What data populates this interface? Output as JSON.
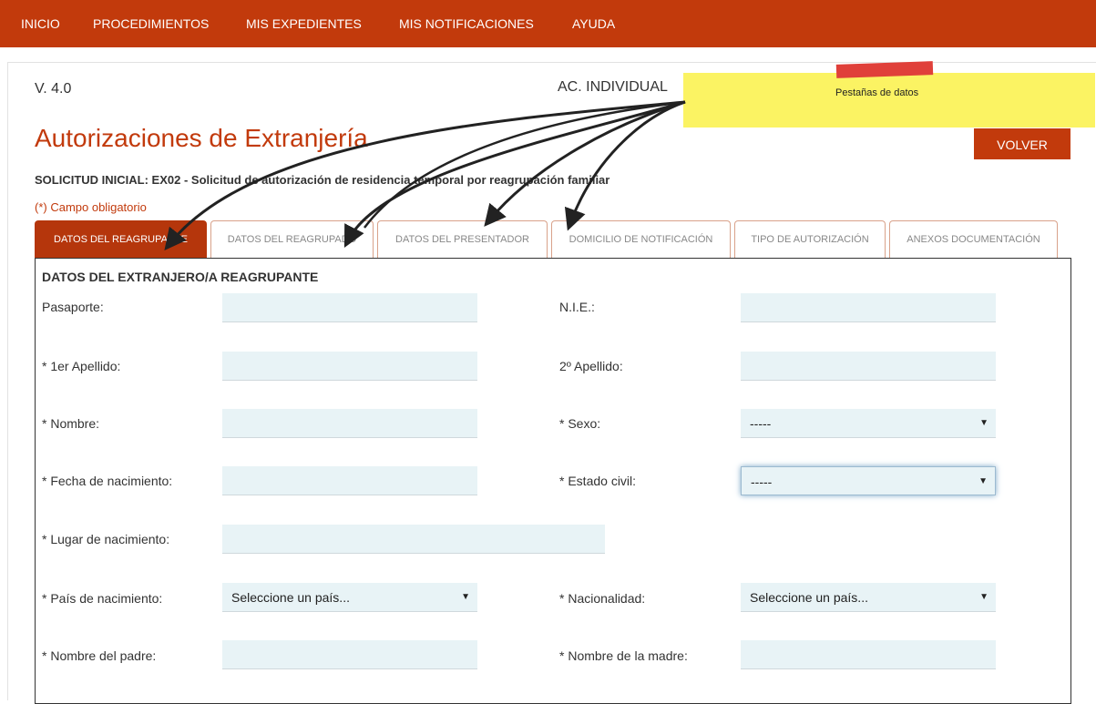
{
  "nav": {
    "items": [
      "INICIO",
      "PROCEDIMIENTOS",
      "MIS EXPEDIENTES",
      "MIS NOTIFICACIONES",
      "AYUDA"
    ]
  },
  "header": {
    "version": "V. 4.0",
    "mode": "AC. INDIVIDUAL",
    "title": "Autorizaciones de Extranjería",
    "volver_label": "VOLVER",
    "subtitle": "SOLICITUD INICIAL: EX02 - Solicitud de autorización de residencia temporal por reagrupación familiar",
    "required_note": "(*) Campo obligatorio"
  },
  "tabs": [
    "DATOS DEL REAGRUPANTE",
    "DATOS DEL REAGRUPADO",
    "DATOS DEL PRESENTADOR",
    "DOMICILIO DE NOTIFICACIÓN",
    "TIPO DE AUTORIZACIÓN",
    "ANEXOS DOCUMENTACIÓN"
  ],
  "active_tab": "DATOS DEL REAGRUPANTE",
  "form": {
    "section_title": "DATOS DEL EXTRANJERO/A REAGRUPANTE",
    "labels": {
      "pasaporte": "Pasaporte:",
      "nie": "N.I.E.:",
      "apellido1": "* 1er Apellido:",
      "apellido2": "2º Apellido:",
      "nombre": "* Nombre:",
      "sexo": "* Sexo:",
      "fecha_nacimiento": "* Fecha de nacimiento:",
      "estado_civil": "* Estado civil:",
      "lugar_nacimiento": "* Lugar de nacimiento:",
      "pais_nacimiento": "* País de nacimiento:",
      "nacionalidad": "* Nacionalidad:",
      "nombre_padre": "* Nombre del padre:",
      "nombre_madre": "* Nombre de la madre:"
    },
    "values": {
      "pasaporte": "",
      "nie": "",
      "apellido1": "",
      "apellido2": "",
      "nombre": "",
      "fecha_nacimiento": "",
      "lugar_nacimiento": "",
      "nombre_padre": "",
      "nombre_madre": ""
    },
    "selects": {
      "sexo": "-----",
      "estado_civil": "-----",
      "pais_nacimiento": "Seleccione un país...",
      "nacionalidad": "Seleccione un país..."
    }
  },
  "annotation": {
    "text": "Pestañas de datos"
  },
  "colors": {
    "brand": "#c23a0c",
    "active_tab": "#b5360c",
    "input_bg": "#e8f3f6",
    "highlight": "#fbf25b",
    "annotation_red": "#e0403a"
  }
}
